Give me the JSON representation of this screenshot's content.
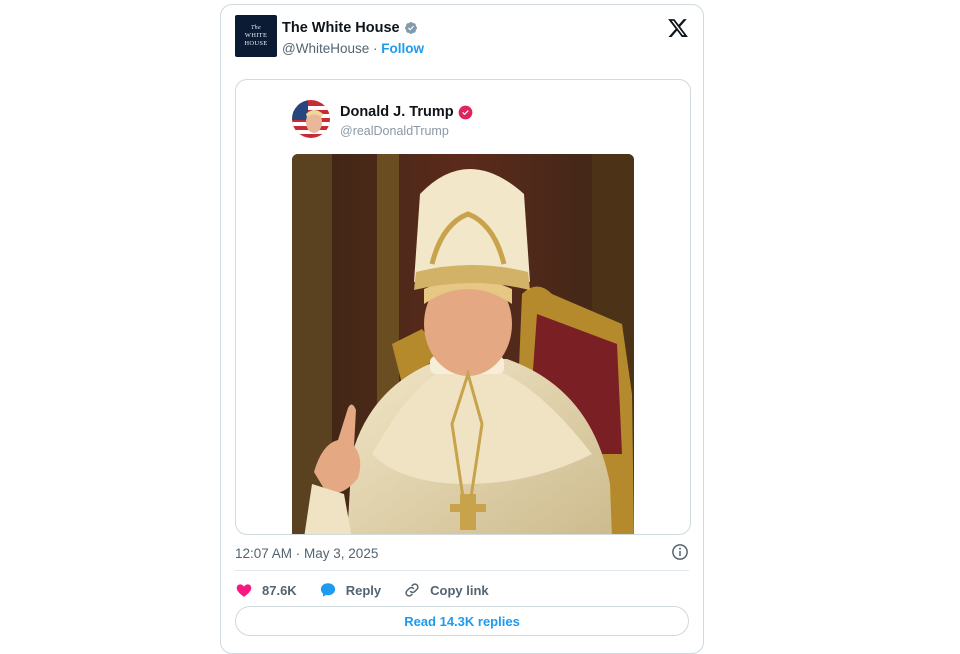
{
  "embed": {
    "author_name": "The White House",
    "author_handle": "@WhiteHouse",
    "separator": "·",
    "follow_label": "Follow",
    "logo_text_line1": "The",
    "logo_text_line2": "WHITE",
    "logo_text_line3": "HOUSE",
    "x_logo_icon": "x-logo-icon"
  },
  "quoted": {
    "author_name": "Donald J. Trump",
    "author_handle": "@realDonaldTrump",
    "verified_color": "#e0245e",
    "media_icon": "pope-portrait-image"
  },
  "footer": {
    "timestamp": "12:07 AM · May 3, 2025",
    "like_count": "87.6K",
    "reply_label": "Reply",
    "copy_link_label": "Copy link",
    "read_replies_label": "Read 14.3K replies"
  },
  "colors": {
    "accent": "#1d9bf0",
    "like": "#f91880",
    "muted": "#536471",
    "border": "#cfd9de"
  }
}
